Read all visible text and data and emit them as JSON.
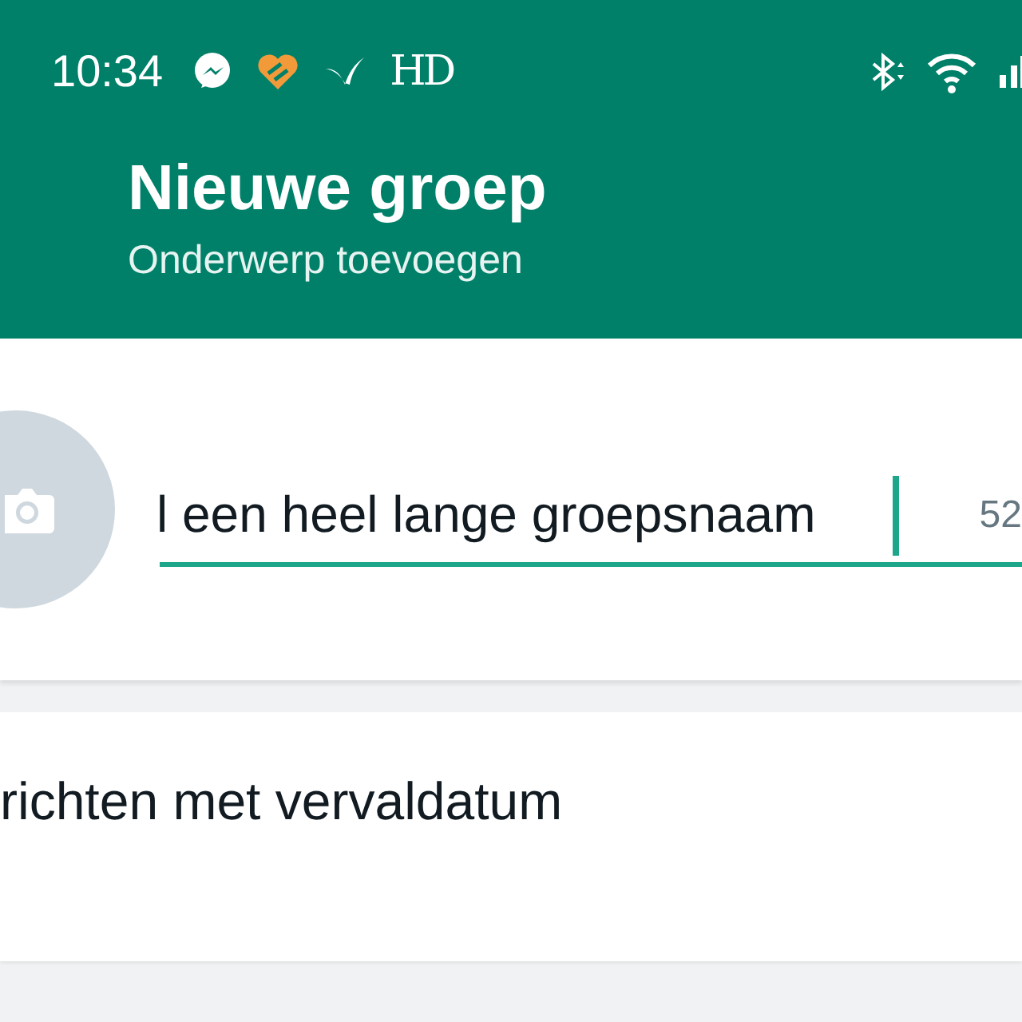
{
  "status_bar": {
    "time": "10:34",
    "hd_label": "HD"
  },
  "header": {
    "title": "Nieuwe groep",
    "subtitle": "Onderwerp toevoegen"
  },
  "group_name_field": {
    "value": "l een heel lange groepsnaam",
    "counter": "52"
  },
  "settings": [
    {
      "label": "richten met vervaldatum"
    }
  ]
}
